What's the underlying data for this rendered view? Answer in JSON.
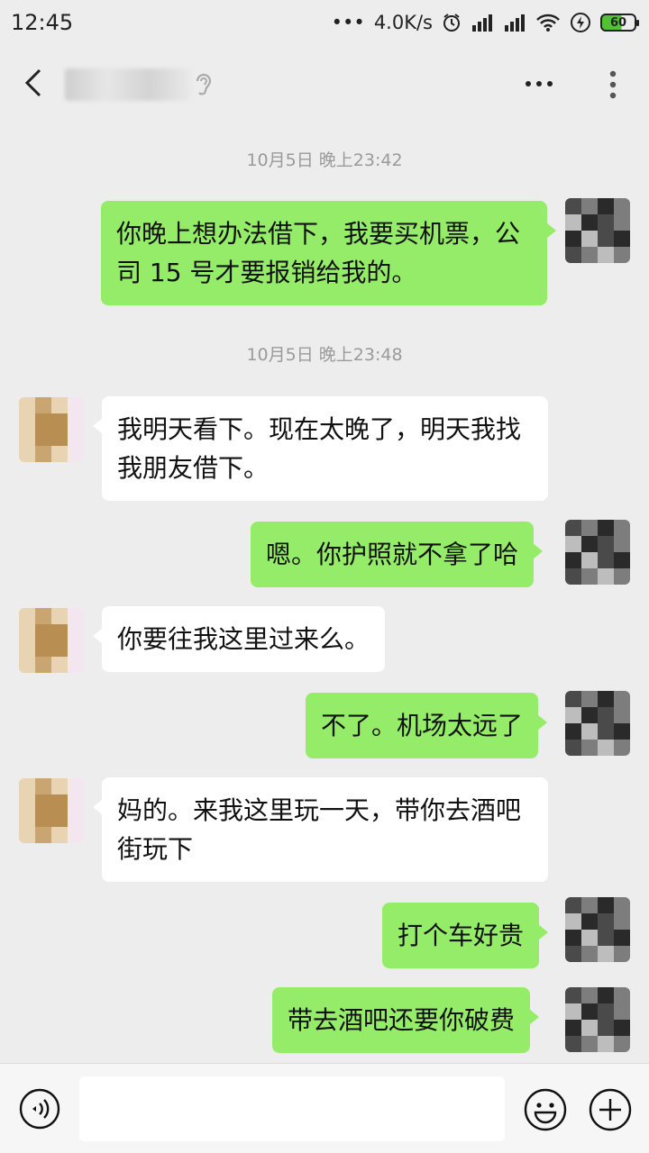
{
  "status_bar": {
    "time": "12:45",
    "net_speed": "4.0K/s",
    "battery": "60"
  },
  "header": {
    "contact_name": "",
    "icons": [
      "back-icon",
      "ear-icon",
      "more-horizontal-icon",
      "more-vertical-icon"
    ]
  },
  "messages": [
    {
      "type": "timestamp",
      "text": "10月5日 晚上23:42"
    },
    {
      "type": "sent",
      "text": "你晚上想办法借下，我要买机票，公司 15 号才要报销给我的。"
    },
    {
      "type": "timestamp",
      "text": "10月5日 晚上23:48"
    },
    {
      "type": "received",
      "text": "我明天看下。现在太晚了，明天我找我朋友借下。"
    },
    {
      "type": "sent",
      "text": "嗯。你护照就不拿了哈"
    },
    {
      "type": "received",
      "text": "你要往我这里过来么。"
    },
    {
      "type": "sent",
      "text": "不了。机场太远了"
    },
    {
      "type": "received",
      "text": "妈的。来我这里玩一天，带你去酒吧街玩下"
    },
    {
      "type": "sent",
      "text": "打个车好贵"
    },
    {
      "type": "sent",
      "text": "带去酒吧还要你破费"
    }
  ],
  "input_bar": {
    "text_value": "",
    "icons": [
      "voice-icon",
      "emoji-icon",
      "plus-icon"
    ]
  },
  "colors": {
    "sent_bubble": "#95ec69",
    "received_bubble": "#ffffff",
    "background": "#ededed"
  }
}
